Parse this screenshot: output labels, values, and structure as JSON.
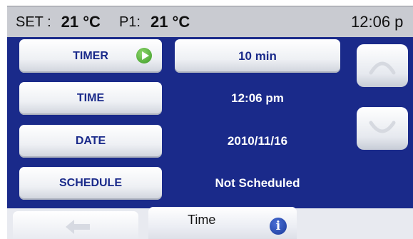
{
  "status": {
    "set_label": "SET :",
    "set_value": "21 °C",
    "p1_label": "P1:",
    "p1_value": "21 °C",
    "clock": "12:06 p"
  },
  "rows": [
    {
      "label": "TIMER",
      "value": "10 min"
    },
    {
      "label": "TIME",
      "value": "12:06 pm"
    },
    {
      "label": "DATE",
      "value": "2010/11/16"
    },
    {
      "label": "SCHEDULE",
      "value": "Not Scheduled"
    }
  ],
  "footer": {
    "tab_label": "Time"
  },
  "colors": {
    "panel": "#1a2a8a",
    "status_bar": "#c9cbd1",
    "play_icon": "#3b9a25",
    "info_icon": "#1a3a9a"
  }
}
